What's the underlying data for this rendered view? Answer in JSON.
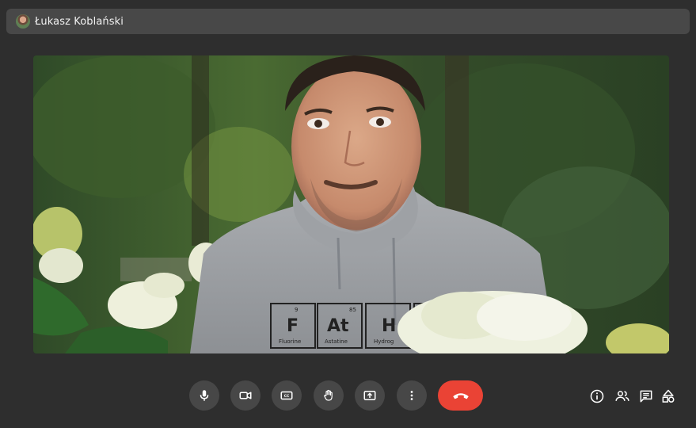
{
  "participant": {
    "name": "Łukasz Koblański"
  },
  "shirt_tiles": [
    {
      "number": "9",
      "symbol": "F",
      "label": "Fluorine"
    },
    {
      "number": "85",
      "symbol": "At",
      "label": "Astatine"
    },
    {
      "number": "",
      "symbol": "H",
      "label": "Hydrog"
    }
  ],
  "controls": {
    "mic_icon": "mic-icon",
    "camera_icon": "camera-icon",
    "cc_label": "CC",
    "hand_icon": "raise-hand-icon",
    "present_icon": "present-icon",
    "more_icon": "more-vert-icon",
    "end_icon": "call-end-icon"
  },
  "side_controls": [
    "info-icon",
    "people-icon",
    "chat-icon",
    "activities-icon"
  ],
  "colors": {
    "background": "#2e2e2e",
    "top_bar": "#484848",
    "button": "#474747",
    "end_call": "#ea4335",
    "icon": "#ffffff"
  }
}
